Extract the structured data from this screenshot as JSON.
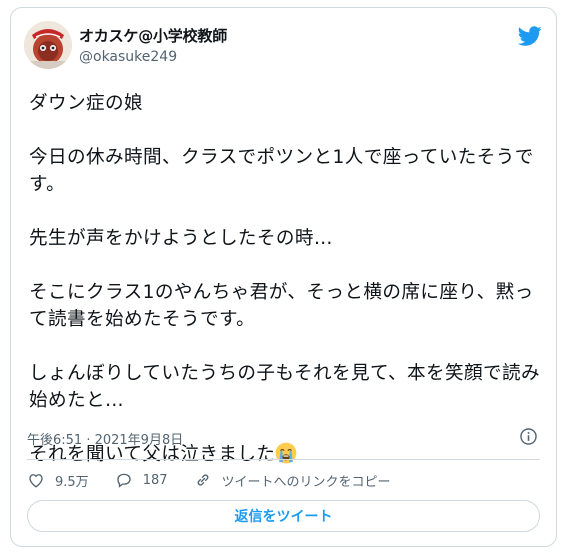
{
  "user": {
    "display_name": "オカスケ@小学校教師",
    "handle": "@okasuke249"
  },
  "tweet": {
    "text": "ダウン症の娘\n\n今日の休み時間、クラスでポツンと1人で座っていたそうです。\n\n先生が声をかけようとしたその時…\n\nそこにクラス1のやんちゃ君が、そっと横の席に座り、黙って読書を始めたそうです。\n\nしょんぼりしていたうちの子もそれを見て、本を笑顔で読み始めたと…\n\nそれを聞いて父は泣きました",
    "emoji": "loudly-crying-face-icon"
  },
  "meta": {
    "timestamp": "午後6:51 · 2021年9月8日"
  },
  "actions": {
    "likes": "9.5万",
    "replies": "187",
    "copy_link": "ツイートへのリンクをコピー"
  },
  "reply_button": {
    "label": "返信をツイート"
  },
  "colors": {
    "accent": "#1d9bf0",
    "secondary_text": "#536471",
    "border": "#cfd9de"
  }
}
